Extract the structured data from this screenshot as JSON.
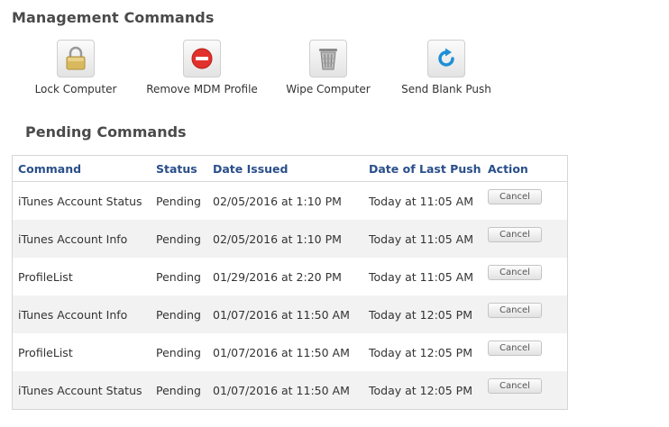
{
  "management": {
    "title": "Management Commands",
    "commands": [
      {
        "label": "Lock Computer",
        "icon": "lock-icon"
      },
      {
        "label": "Remove MDM Profile",
        "icon": "no-entry-icon"
      },
      {
        "label": "Wipe Computer",
        "icon": "trash-icon"
      },
      {
        "label": "Send Blank Push",
        "icon": "refresh-icon"
      }
    ]
  },
  "pending": {
    "title": "Pending Commands",
    "columns": [
      "Command",
      "Status",
      "Date Issued",
      "Date of Last Push",
      "Action"
    ],
    "cancel_label": "Cancel",
    "rows": [
      {
        "command": "iTunes Account Status",
        "status": "Pending",
        "date_issued": "02/05/2016 at 1:10 PM",
        "last_push": "Today at 11:05 AM"
      },
      {
        "command": "iTunes Account Info",
        "status": "Pending",
        "date_issued": "02/05/2016 at 1:10 PM",
        "last_push": "Today at 11:05 AM"
      },
      {
        "command": "ProfileList",
        "status": "Pending",
        "date_issued": "01/29/2016 at 2:20 PM",
        "last_push": "Today at 11:05 AM"
      },
      {
        "command": "iTunes Account Info",
        "status": "Pending",
        "date_issued": "01/07/2016 at 11:50 AM",
        "last_push": "Today at 12:05 PM"
      },
      {
        "command": "ProfileList",
        "status": "Pending",
        "date_issued": "01/07/2016 at 11:50 AM",
        "last_push": "Today at 12:05 PM"
      },
      {
        "command": "iTunes Account Status",
        "status": "Pending",
        "date_issued": "01/07/2016 at 11:50 AM",
        "last_push": "Today at 12:05 PM"
      }
    ]
  },
  "colors": {
    "header_text": "#2a4f8a",
    "stripe": "#f2f2f2",
    "remove_red": "#e2312c",
    "push_blue": "#1e8fd6"
  }
}
